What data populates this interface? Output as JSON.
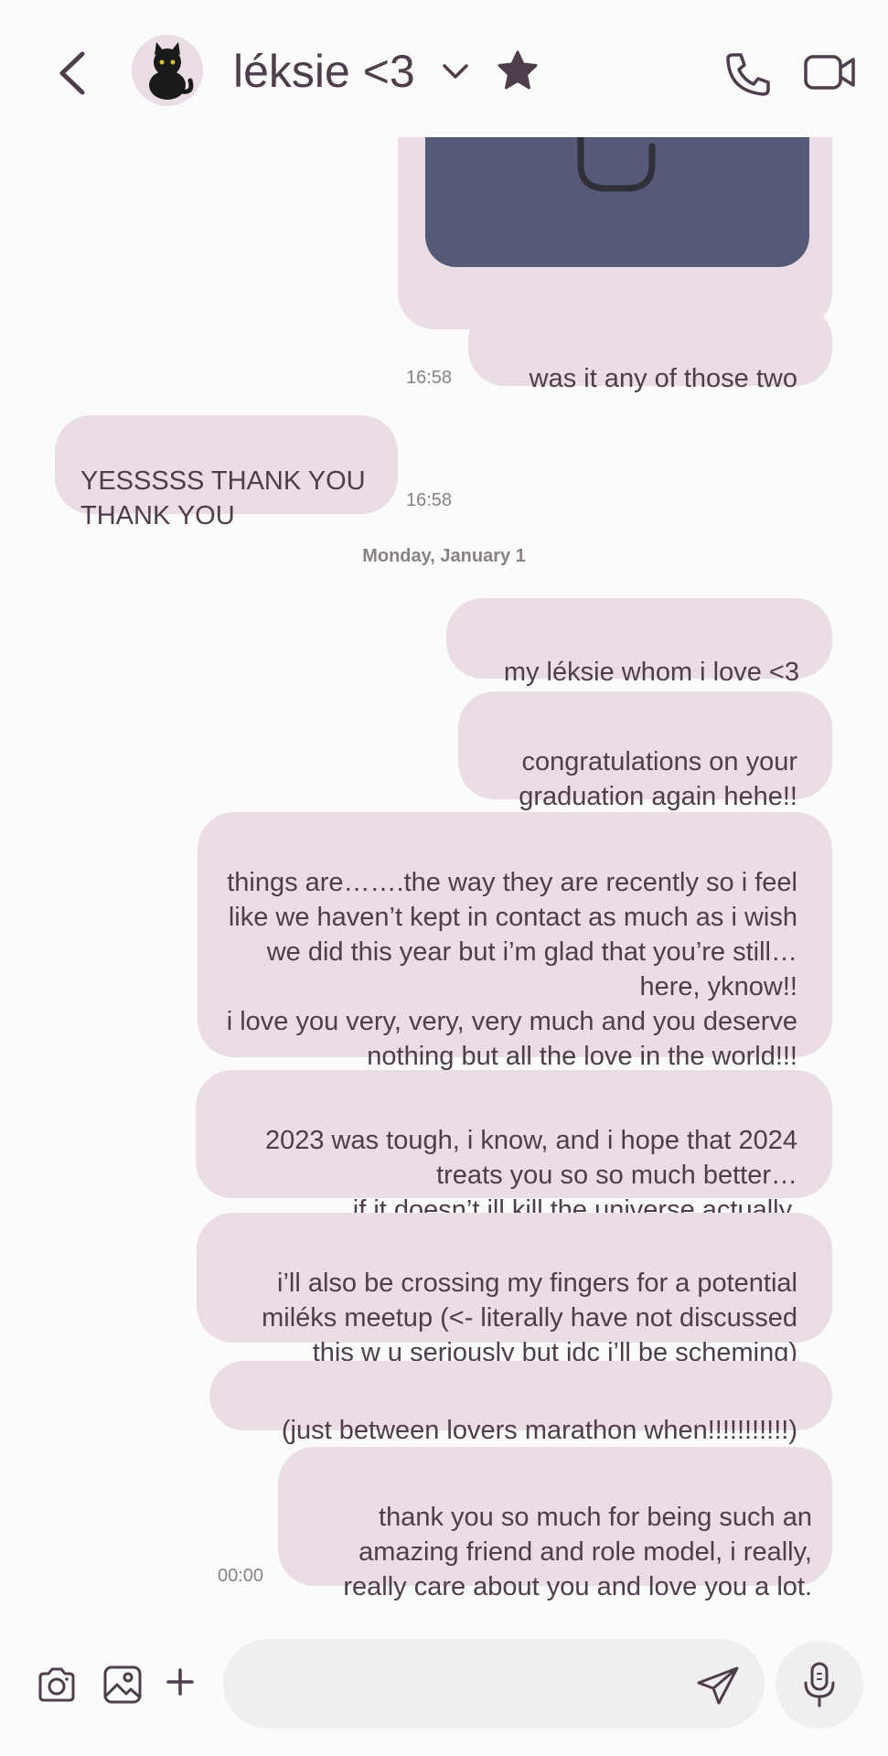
{
  "header": {
    "contact_name": "léksie <3",
    "icons": [
      "back-arrow-icon",
      "cat-avatar",
      "chevron-down-icon",
      "star-icon",
      "phone-icon",
      "video-icon"
    ]
  },
  "messages": [
    {
      "id": "m1",
      "direction": "outgoing",
      "text": "was it any of those two",
      "time": "16:58"
    },
    {
      "id": "m2",
      "direction": "incoming",
      "text": "YESSSSS THANK YOU THANK YOU",
      "time": "16:58"
    },
    {
      "id": "m3",
      "direction": "outgoing",
      "text": "my léksie whom i love <3"
    },
    {
      "id": "m4",
      "direction": "outgoing",
      "text": "congratulations on your graduation again hehe!!"
    },
    {
      "id": "m5",
      "direction": "outgoing",
      "text": "things are…….the way they are recently so i feel like we haven’t kept in contact as much as i wish we did this year but i’m glad that you’re still… here, yknow!!\ni love you very, very, very much and you deserve nothing but all the love in the world!!!"
    },
    {
      "id": "m6",
      "direction": "outgoing",
      "text": "2023 was tough, i know, and i hope that 2024 treats you so so much better…\nif it doesn’t ill kill the universe actually."
    },
    {
      "id": "m7",
      "direction": "outgoing",
      "text": "i’ll also be crossing my fingers for a potential miléks meetup (<- literally have not discussed this w u seriously but idc i’ll be scheming)"
    },
    {
      "id": "m8",
      "direction": "outgoing",
      "text": "(just between lovers marathon when!!!!!!!!!!!)"
    },
    {
      "id": "m9",
      "direction": "outgoing",
      "text": "thank you so much for being such an amazing friend and role model, i really, really care about you and love you a lot.",
      "time": "00:00"
    }
  ],
  "date_separator": "Monday, January 1",
  "composer": {
    "icons": [
      "camera-icon",
      "gallery-icon",
      "plus-icon",
      "send-icon",
      "microphone-icon"
    ]
  },
  "colors": {
    "background": "#fcfbfc",
    "bubble": "#eadde6",
    "text": "#4e3d4a",
    "image": "#555b77"
  }
}
